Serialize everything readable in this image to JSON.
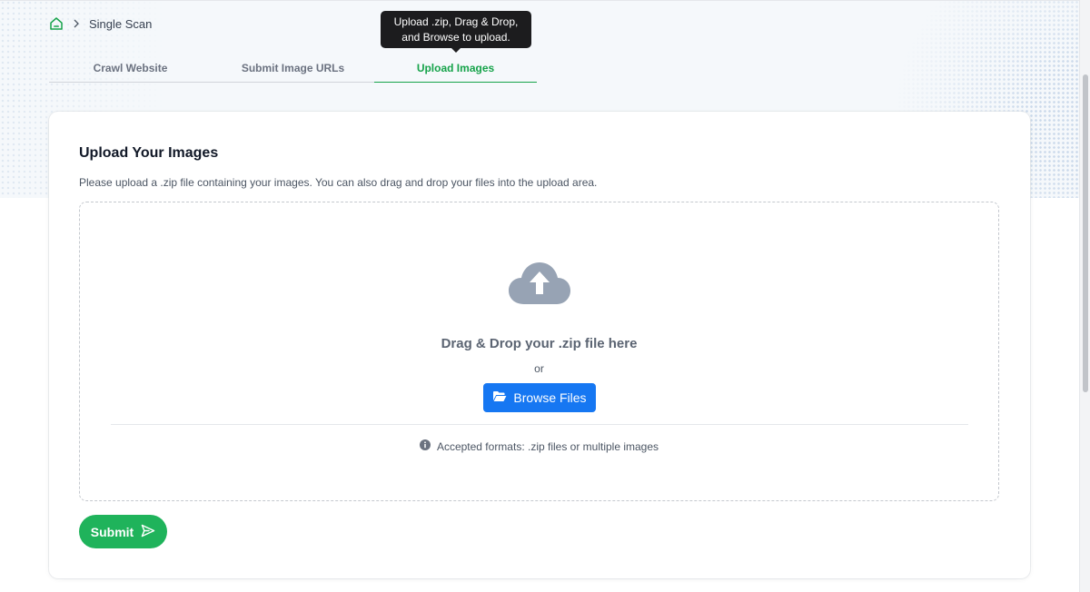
{
  "breadcrumb": {
    "home_icon": "home-icon",
    "separator_icon": "chevron-right-icon",
    "current": "Single Scan"
  },
  "tooltip": {
    "line1": "Upload .zip, Drag & Drop,",
    "line2": "and Browse to upload."
  },
  "tabs": [
    {
      "label": "Crawl Website",
      "active": false
    },
    {
      "label": "Submit Image URLs",
      "active": false
    },
    {
      "label": "Upload Images",
      "active": true
    }
  ],
  "card": {
    "title": "Upload Your Images",
    "description": "Please upload a .zip file containing your images. You can also drag and drop your files into the upload area."
  },
  "dropzone": {
    "icon": "cloud-upload-icon",
    "title": "Drag & Drop your .zip file here",
    "or_text": "or",
    "browse_label": "Browse Files",
    "browse_icon": "folder-open-icon",
    "note_icon": "info-icon",
    "note": "Accepted formats: .zip files or multiple images"
  },
  "submit": {
    "label": "Submit",
    "icon": "send-icon"
  },
  "colors": {
    "accent_green": "#16a34a",
    "submit_green": "#1fb35b",
    "browse_blue": "#1677f2",
    "tooltip_bg": "#1c1c1e"
  }
}
